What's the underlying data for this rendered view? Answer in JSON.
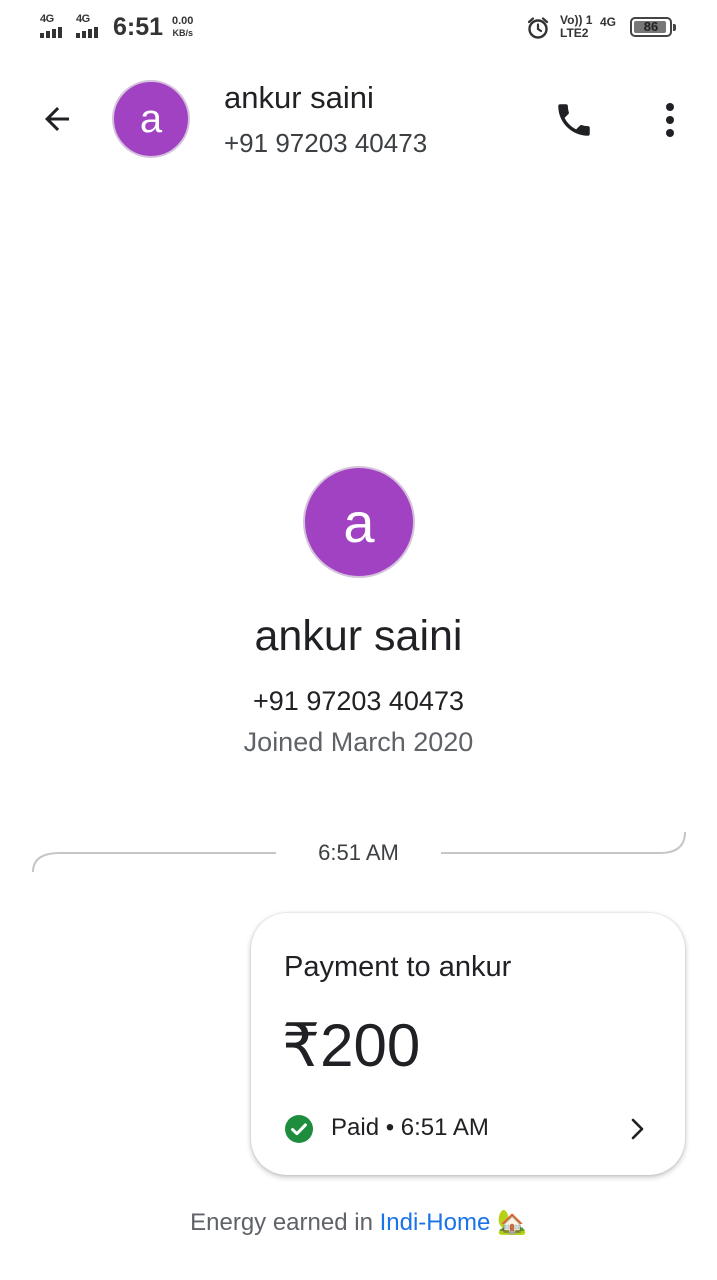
{
  "status_bar": {
    "sim1_network": "4G",
    "sim2_network": "4G",
    "time": "6:51",
    "speed_value": "0.00",
    "speed_unit": "KB/s",
    "volte_label": "Vo)) 1",
    "lte_label": "LTE2",
    "network_label": "4G",
    "battery_level": "86",
    "icons": [
      "signal-icon",
      "alarm-icon",
      "battery-icon"
    ]
  },
  "header": {
    "avatar_letter": "a",
    "name": "ankur saini",
    "phone": "+91 97203 40473",
    "icons": [
      "back-arrow-icon",
      "phone-icon",
      "more-vert-icon"
    ]
  },
  "profile": {
    "avatar_letter": "a",
    "name": "ankur saini",
    "phone": "+91 97203 40473",
    "joined": "Joined March 2020"
  },
  "conversation": {
    "divider_time": "6:51 AM",
    "payment": {
      "title": "Payment to ankur",
      "amount": "₹200",
      "status": "Paid • 6:51 AM",
      "icons": [
        "check-circle-icon",
        "chevron-right-icon"
      ]
    }
  },
  "footer": {
    "prefix": "Energy earned in ",
    "link": "Indi-Home",
    "emoji": "🏡"
  },
  "colors": {
    "avatar": "#a142c3",
    "link": "#1a73e8",
    "paid_check": "#1e8e3e"
  }
}
